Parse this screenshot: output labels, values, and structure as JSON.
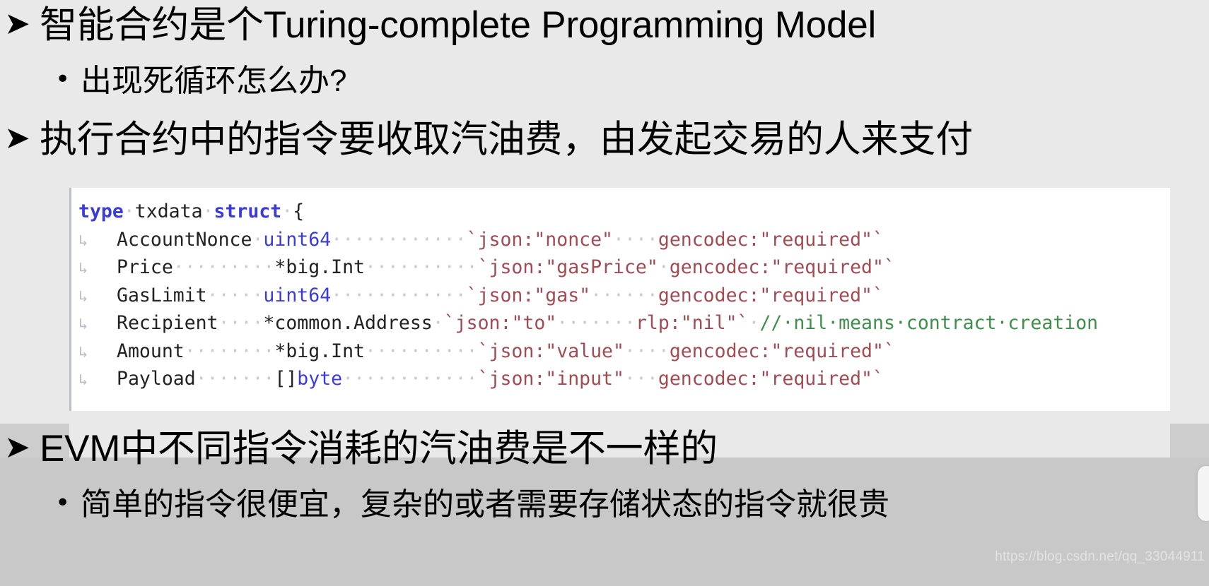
{
  "slide": {
    "background_color": "#e9e9e9",
    "lower_band_color": "#c8c8c8"
  },
  "bullets": [
    {
      "level": 1,
      "marker": "➤",
      "text": "智能合约是个Turing-complete Programming Model"
    },
    {
      "level": 2,
      "marker": "•",
      "text": "出现死循环怎么办?"
    },
    {
      "level": 1,
      "marker": "➤",
      "text": "执行合约中的指令要收取汽油费，由发起交易的人来支付"
    },
    {
      "level": 1,
      "marker": "➤",
      "text": "EVM中不同指令消耗的汽油费是不一样的"
    },
    {
      "level": 2,
      "marker": "•",
      "text": "简单的指令很便宜，复杂的或者需要存储状态的指令就很贵"
    }
  ],
  "code_block": {
    "language": "go",
    "colors": {
      "keyword": "#3b3bd8",
      "type": "#3b3bd8",
      "identifier": "#222222",
      "tag_string": "#a14b52",
      "comment": "#3f8f4b",
      "dot_leader": "#c9cbd0",
      "background": "#ffffff"
    },
    "header": {
      "kw_type": "type",
      "name": "txdata",
      "kw_struct": "struct",
      "brace": "{"
    },
    "fields": [
      {
        "arrow": "↳",
        "name": "AccountNonce",
        "name_pad": 0,
        "type": "uint64",
        "type_is_builtin": true,
        "dots_after_type": 12,
        "tag_json": "`json:\"nonce\"",
        "dots_after_json": 4,
        "tag_rest": "gencodec:\"required\"`",
        "comment": ""
      },
      {
        "arrow": "↳",
        "name": "Price",
        "name_pad": 9,
        "type": "*big.Int",
        "type_is_builtin": false,
        "dots_after_type": 10,
        "tag_json": "`json:\"gasPrice\"",
        "dots_after_json": 1,
        "tag_rest": "gencodec:\"required\"`",
        "comment": ""
      },
      {
        "arrow": "↳",
        "name": "GasLimit",
        "name_pad": 5,
        "type": "uint64",
        "type_is_builtin": true,
        "dots_after_type": 12,
        "tag_json": "`json:\"gas\"",
        "dots_after_json": 6,
        "tag_rest": "gencodec:\"required\"`",
        "comment": ""
      },
      {
        "arrow": "↳",
        "name": "Recipient",
        "name_pad": 4,
        "type": "*common.Address",
        "type_is_builtin": false,
        "dots_after_type": 1,
        "tag_json": "`json:\"to\"",
        "dots_after_json": 7,
        "tag_rest": "rlp:\"nil\"`",
        "comment": "// nil means contract creation"
      },
      {
        "arrow": "↳",
        "name": "Amount",
        "name_pad": 8,
        "type": "*big.Int",
        "type_is_builtin": false,
        "dots_after_type": 10,
        "tag_json": "`json:\"value\"",
        "dots_after_json": 4,
        "tag_rest": "gencodec:\"required\"`",
        "comment": ""
      },
      {
        "arrow": "↳",
        "name": "Payload",
        "name_pad": 7,
        "type": "[]byte",
        "type_is_builtin": true,
        "type_prefix": "[]",
        "type_body": "byte",
        "dots_after_type": 12,
        "tag_json": "`json:\"input\"",
        "dots_after_json": 3,
        "tag_rest": "gencodec:\"required\"`",
        "comment": ""
      }
    ]
  },
  "watermark": {
    "text": "https://blog.csdn.net/qq_33044911"
  }
}
